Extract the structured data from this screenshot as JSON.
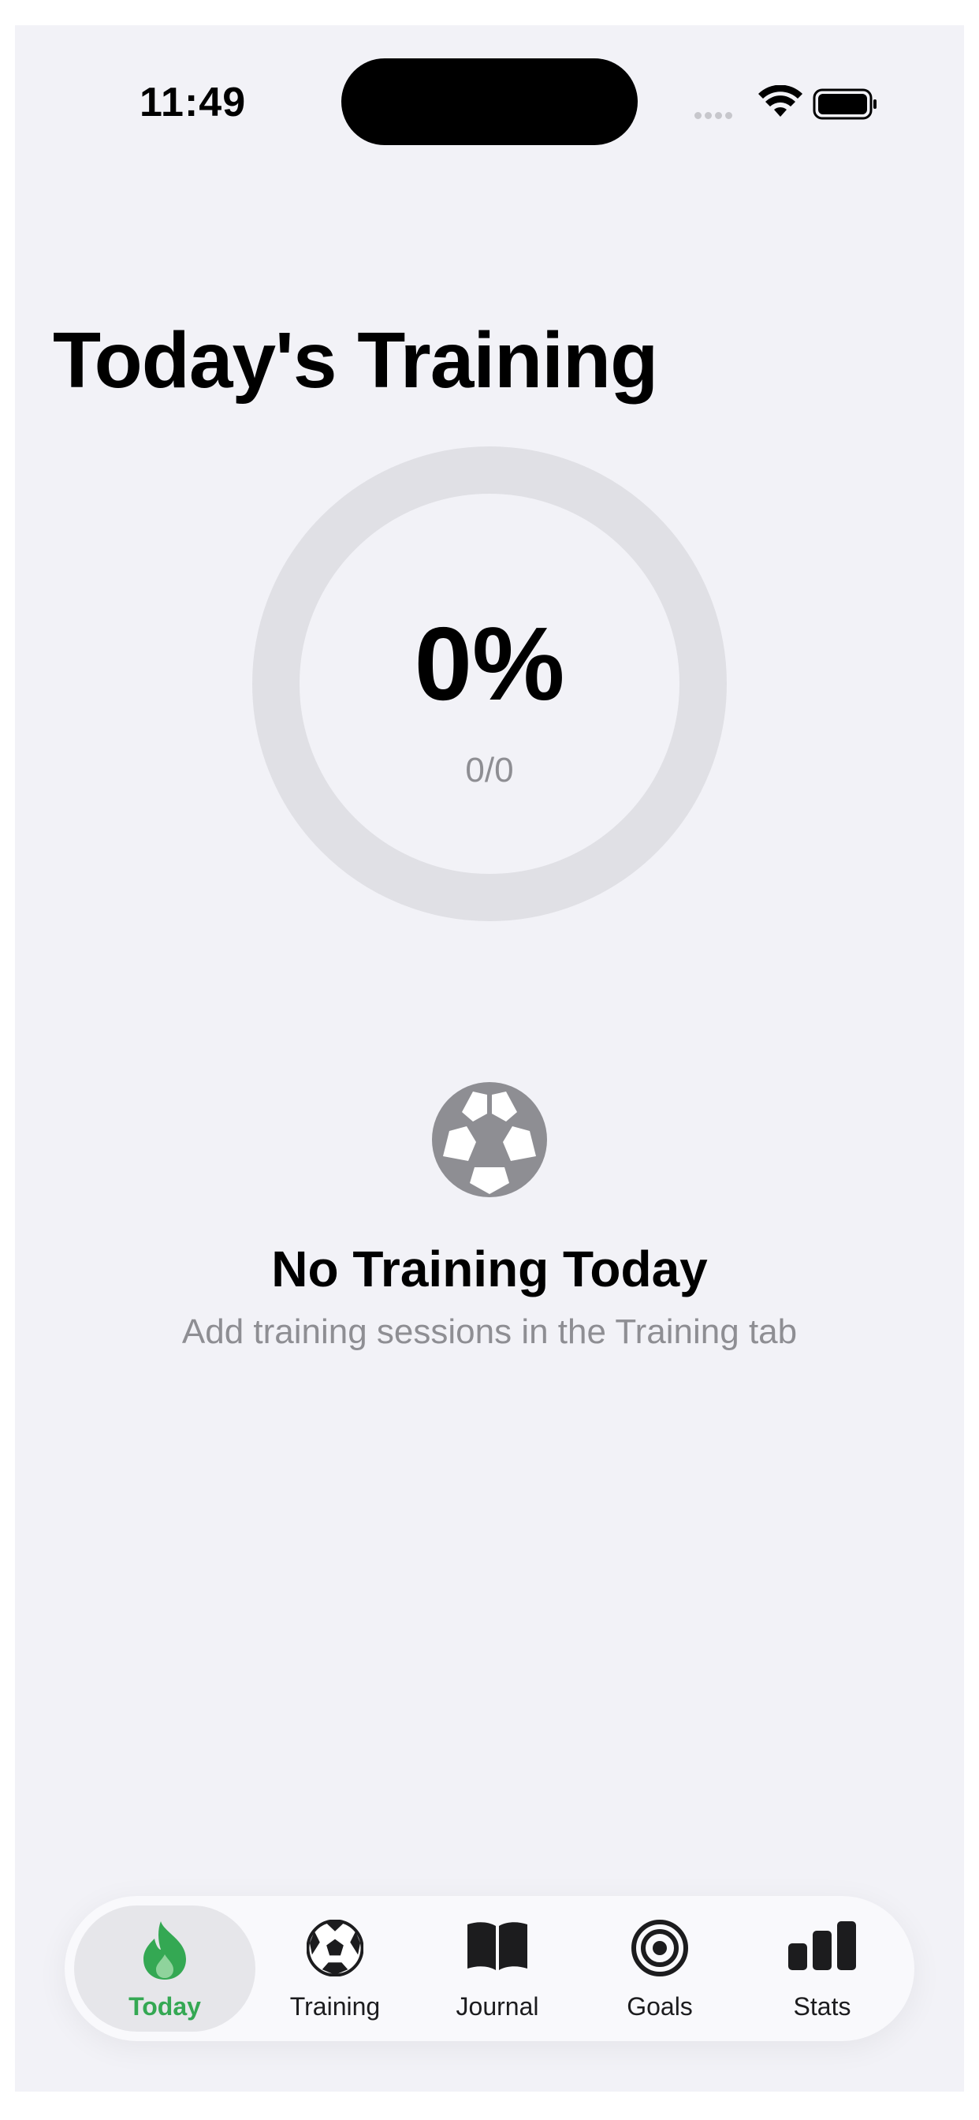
{
  "status": {
    "time": "11:49"
  },
  "page": {
    "title": "Today's Training"
  },
  "progress": {
    "percent_label": "0%",
    "count_label": "0/0",
    "fraction": 0
  },
  "empty_state": {
    "icon": "soccer-ball-icon",
    "title": "No Training Today",
    "subtitle": "Add training sessions in the Training tab"
  },
  "tabs": [
    {
      "label": "Today",
      "icon": "flame-icon",
      "active": true
    },
    {
      "label": "Training",
      "icon": "soccer-ball-icon",
      "active": false
    },
    {
      "label": "Journal",
      "icon": "book-icon",
      "active": false
    },
    {
      "label": "Goals",
      "icon": "target-icon",
      "active": false
    },
    {
      "label": "Stats",
      "icon": "bar-chart-icon",
      "active": false
    }
  ],
  "colors": {
    "accent": "#34a853",
    "background": "#f2f2f7",
    "ring_track": "#e0e0e5",
    "secondary_text": "#8e8e93"
  }
}
